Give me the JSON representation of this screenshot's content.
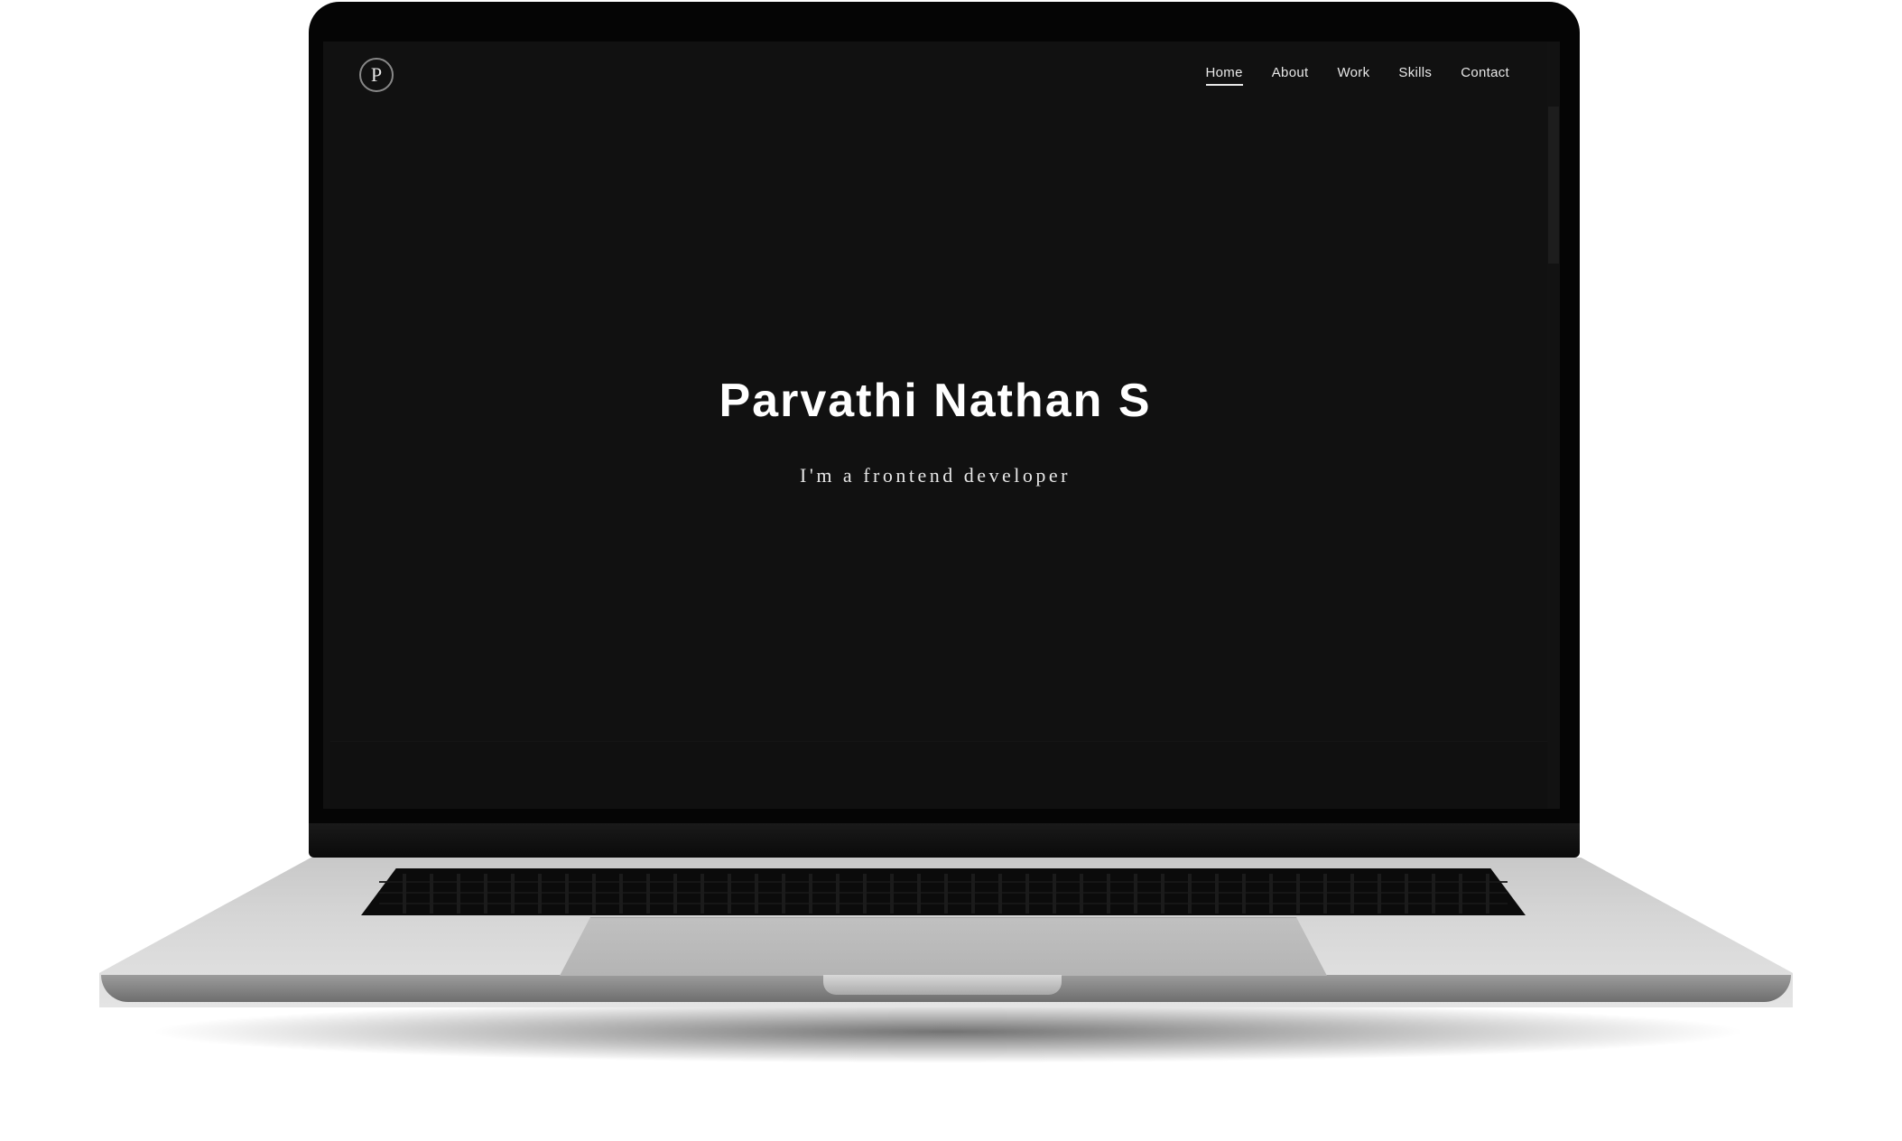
{
  "site": {
    "logo_letter": "P",
    "nav": [
      {
        "label": "Home",
        "active": true
      },
      {
        "label": "About",
        "active": false
      },
      {
        "label": "Work",
        "active": false
      },
      {
        "label": "Skills",
        "active": false
      },
      {
        "label": "Contact",
        "active": false
      }
    ],
    "hero": {
      "title": "Parvathi Nathan S",
      "subtitle": "I'm a frontend developer"
    }
  },
  "colors": {
    "screen_bg": "#111111",
    "text": "#ffffff"
  }
}
